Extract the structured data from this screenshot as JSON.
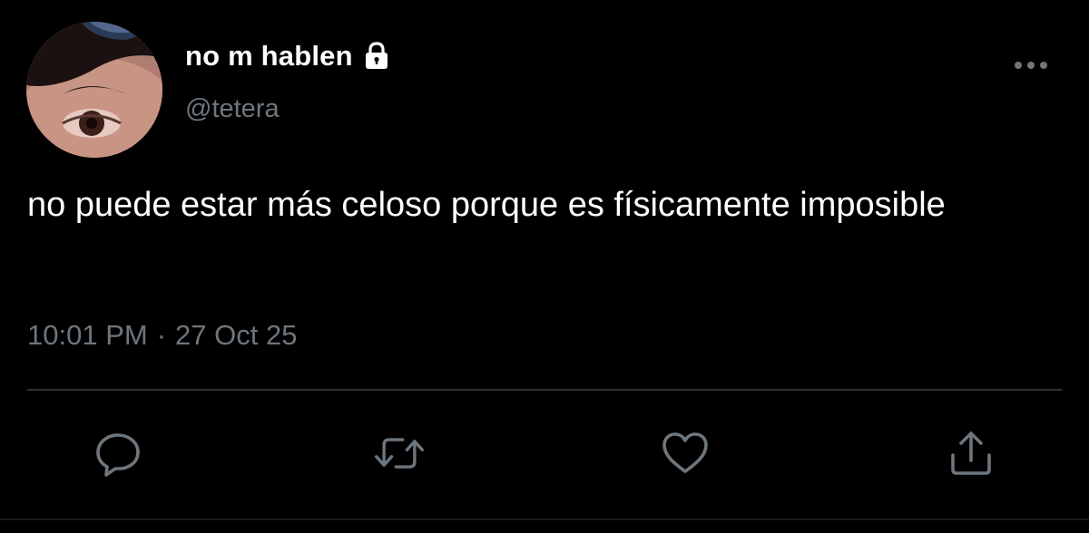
{
  "tweet": {
    "display_name": "no m hablen",
    "handle": "@tetera",
    "protected_icon": "lock-icon",
    "text": "no puede estar más celoso porque es físicamente imposible",
    "time": "10:01 PM",
    "separator": "·",
    "date": "27 Oct 25"
  },
  "actions": {
    "reply_icon": "speech-bubble-icon",
    "retweet_icon": "retweet-icon",
    "like_icon": "heart-icon",
    "share_icon": "share-upload-icon",
    "more_icon": "more-horizontal-icon"
  },
  "colors": {
    "background": "#000000",
    "primary_text": "#ffffff",
    "secondary_text": "#6e767d",
    "divider": "#2f3336",
    "icon": "#6e767d"
  }
}
